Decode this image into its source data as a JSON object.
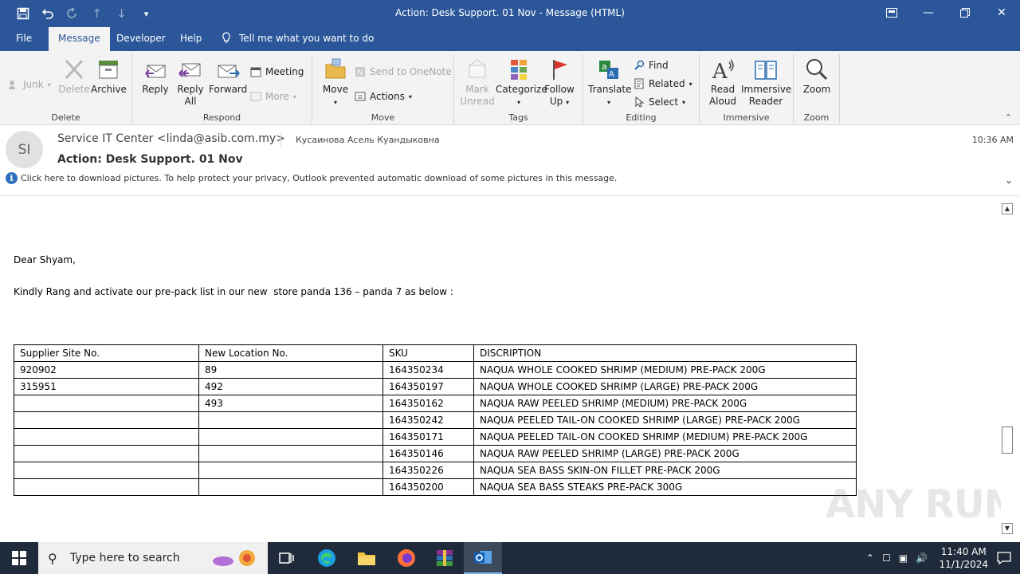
{
  "window": {
    "title": "Action: Desk Support. 01 Nov  -  Message (HTML)",
    "qat_icons": [
      "save-icon",
      "undo-icon",
      "redo-icon",
      "up-icon",
      "down-icon",
      "customize-icon"
    ],
    "accent": "#2b579a"
  },
  "tabs": [
    "File",
    "Message",
    "Developer",
    "Help"
  ],
  "active_tab": "Message",
  "tellme": "Tell me what you want to do",
  "ribbon": {
    "delete_group": {
      "label": "Delete",
      "junk": "Junk",
      "delete": "Delete",
      "archive": "Archive"
    },
    "respond_group": {
      "label": "Respond",
      "reply": "Reply",
      "reply_all_1": "Reply",
      "reply_all_2": "All",
      "forward": "Forward",
      "meeting": "Meeting",
      "more": "More"
    },
    "move_group": {
      "label": "Move",
      "move": "Move",
      "onenote": "Send to OneNote",
      "actions": "Actions"
    },
    "tags_group": {
      "label": "Tags",
      "mark_1": "Mark",
      "mark_2": "Unread",
      "categorize": "Categorize",
      "follow_1": "Follow",
      "follow_2": "Up"
    },
    "editing_group": {
      "label": "Editing",
      "translate": "Translate",
      "find": "Find",
      "related": "Related",
      "select": "Select"
    },
    "immersive_group": {
      "label": "Immersive",
      "read_1": "Read",
      "read_2": "Aloud",
      "reader_1": "Immersive",
      "reader_2": "Reader"
    },
    "zoom_group": {
      "label": "Zoom",
      "zoom": "Zoom"
    }
  },
  "message": {
    "avatar_initials": "SI",
    "sender": "Service IT Center <linda@asib.com.my>",
    "recipient": "Кусаинова Асель Куандыковна",
    "time": "10:36 AM",
    "subject": "Action: Desk Support. 01 Nov",
    "info_bar": "Click here to download pictures. To help protect your privacy, Outlook prevented automatic download of some pictures in this message.",
    "greeting": "Dear Shyam,",
    "paragraph": "Kindly Rang and activate our pre-pack list in our new  store panda 136 – panda 7 as below :"
  },
  "table": {
    "headers": [
      "Supplier Site No.",
      "New Location No.",
      "SKU",
      "DISCRIPTION"
    ],
    "rows": [
      [
        "920902",
        "89",
        "164350234",
        "NAQUA WHOLE COOKED SHRIMP (MEDIUM)  PRE-PACK 200G"
      ],
      [
        "315951",
        "492",
        "164350197",
        "NAQUA WHOLE COOKED SHRIMP (LARGE)  PRE-PACK 200G"
      ],
      [
        "",
        "493",
        "164350162",
        "NAQUA RAW PEELED SHRIMP (MEDIUM)  PRE-PACK 200G"
      ],
      [
        "",
        "",
        "164350242",
        "NAQUA PEELED TAIL-ON COOKED SHRIMP (LARGE)  PRE-PACK 200G"
      ],
      [
        "",
        "",
        "164350171",
        "NAQUA PEELED TAIL-ON COOKED SHRIMP (MEDIUM) PRE-PACK 200G"
      ],
      [
        "",
        "",
        "164350146",
        "NAQUA RAW PEELED SHRIMP (LARGE)  PRE-PACK 200G"
      ],
      [
        "",
        "",
        "164350226",
        "NAQUA SEA BASS SKIN-ON FILLET PRE-PACK 200G"
      ],
      [
        "",
        "",
        "164350200",
        "NAQUA SEA BASS STEAKS PRE-PACK 300G"
      ]
    ]
  },
  "watermark": "ANY RUN",
  "taskbar": {
    "search_placeholder": "Type here to search",
    "apps": [
      "task-view-icon",
      "edge-icon",
      "file-explorer-icon",
      "firefox-icon",
      "winrar-icon",
      "outlook-icon"
    ],
    "time": "11:40 AM",
    "date": "11/1/2024"
  }
}
